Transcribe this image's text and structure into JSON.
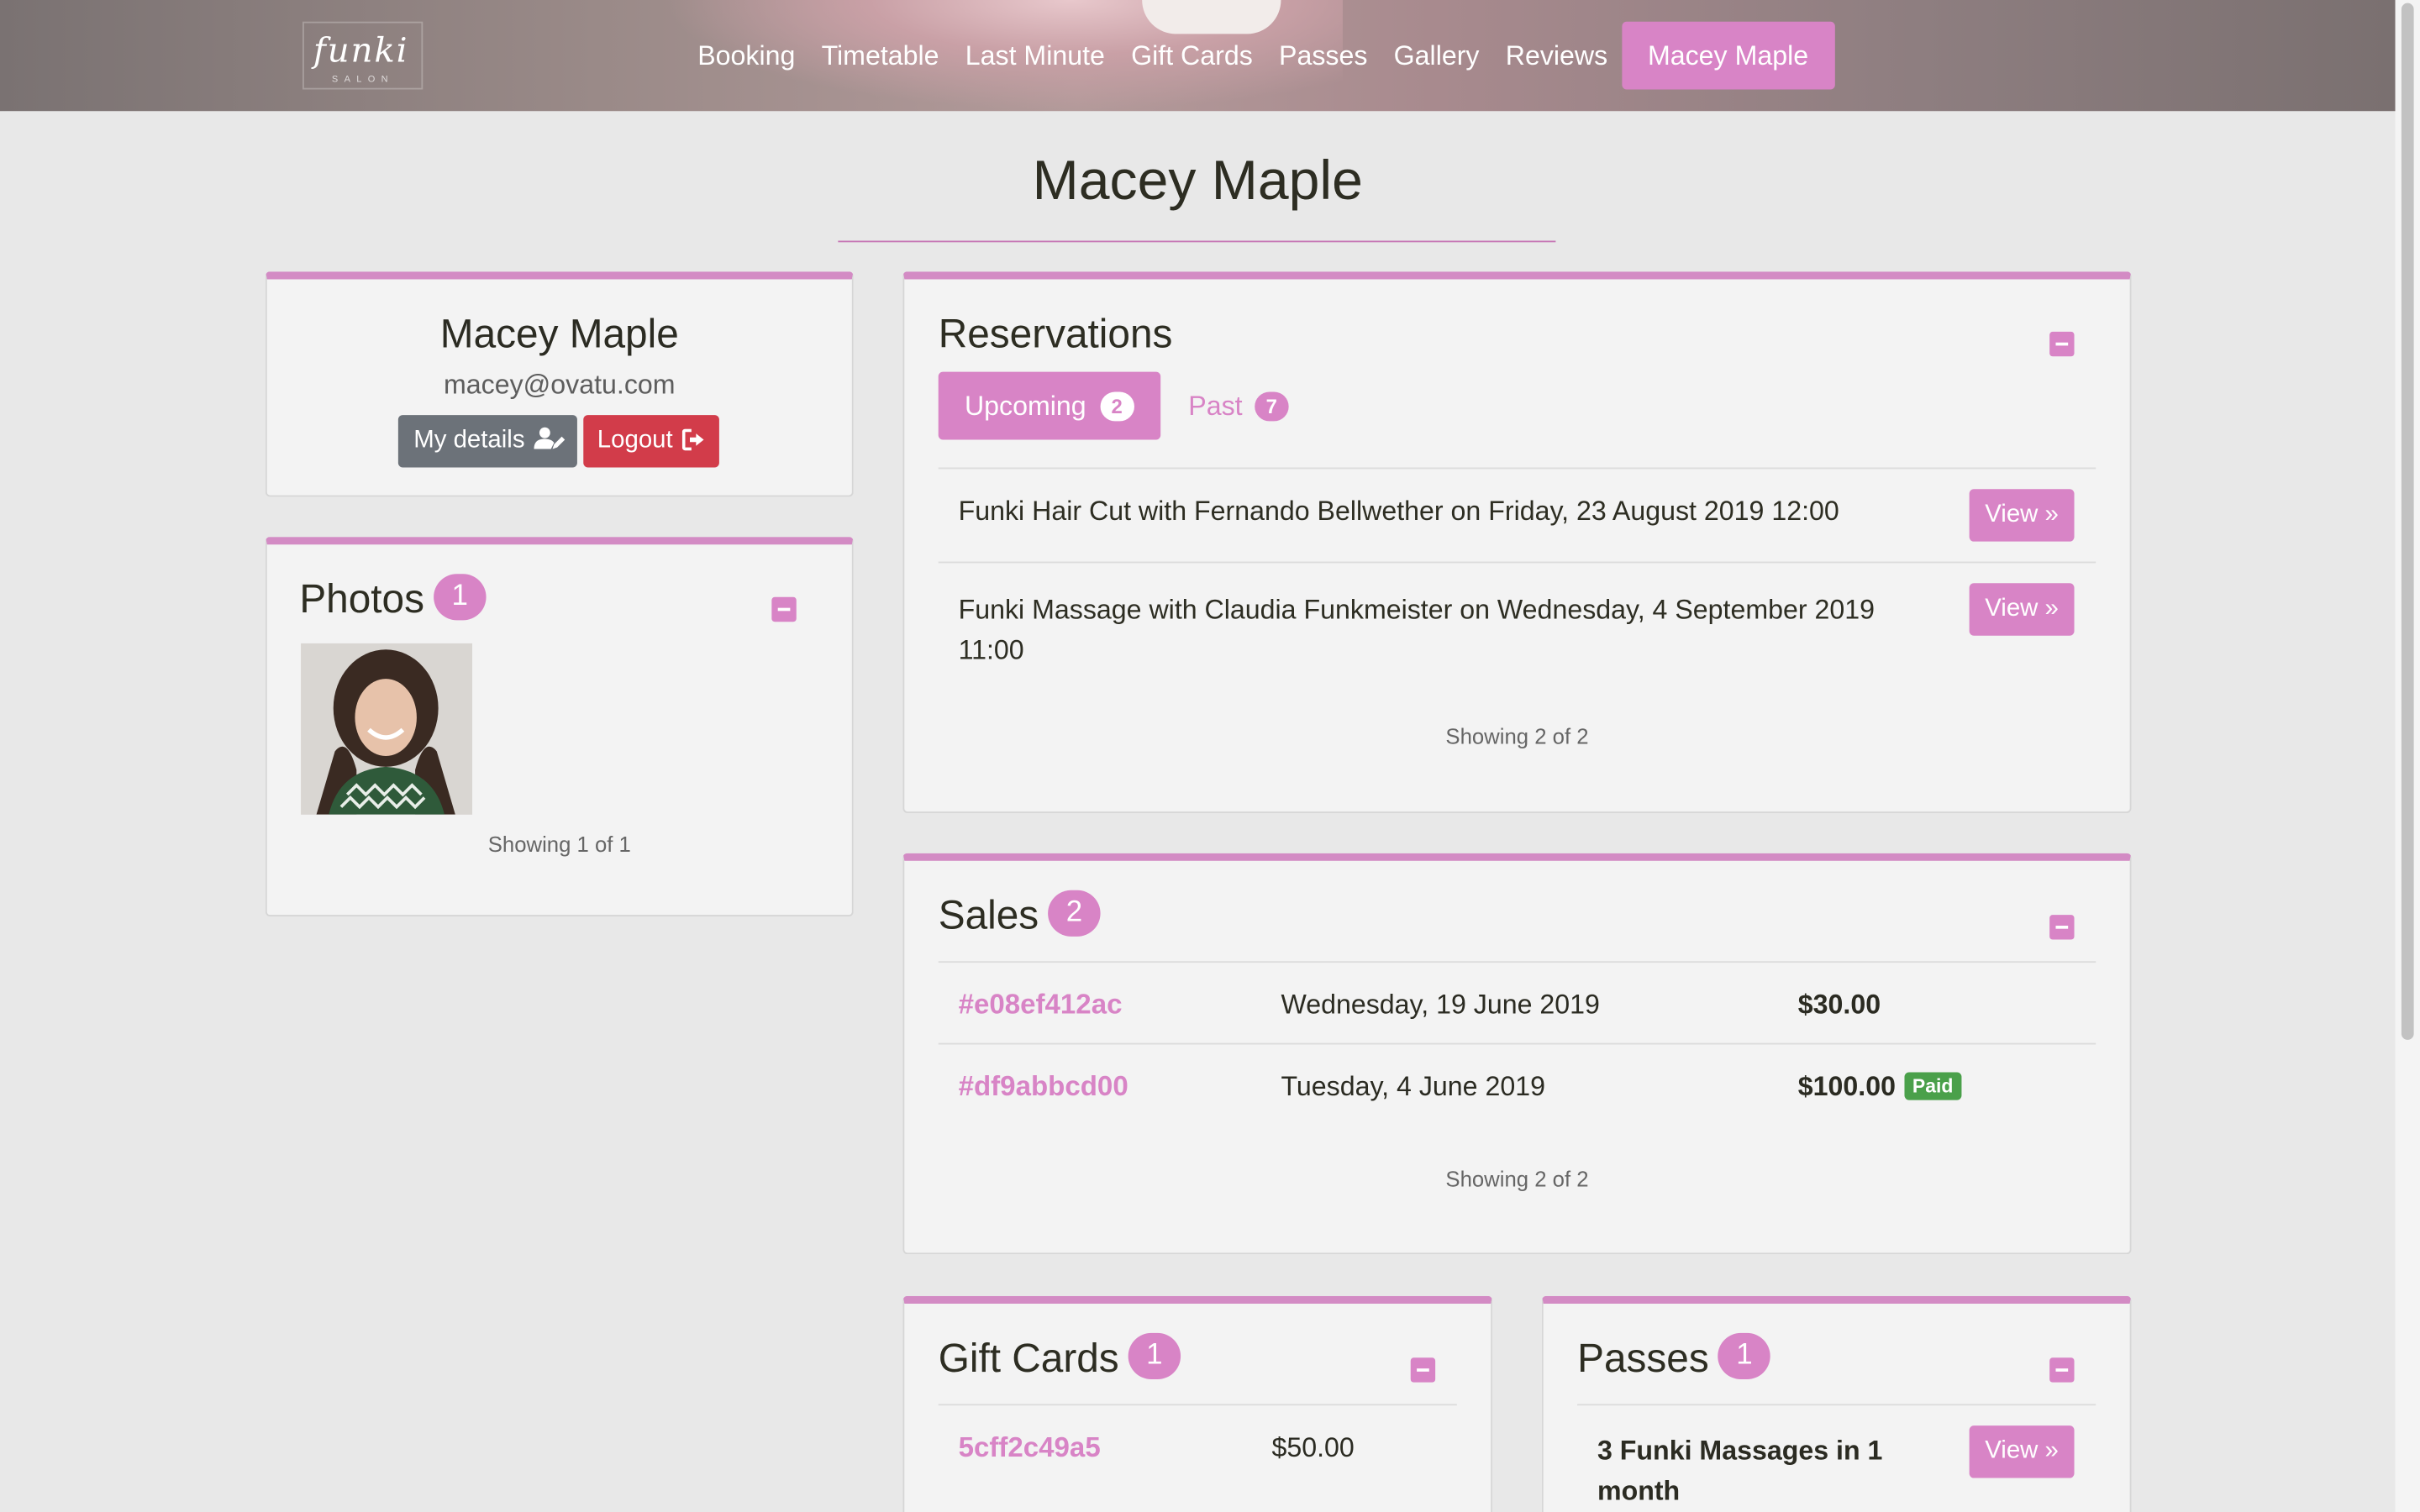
{
  "brand": {
    "logo_text": "funki",
    "logo_sub": "SALON"
  },
  "nav": {
    "items": [
      "Booking",
      "Timetable",
      "Last Minute",
      "Gift Cards",
      "Passes",
      "Gallery",
      "Reviews"
    ],
    "user": "Macey Maple"
  },
  "page_title": "Macey Maple",
  "profile": {
    "name": "Macey Maple",
    "email": "macey@ovatu.com",
    "details_button": "My details",
    "logout_button": "Logout"
  },
  "photos": {
    "title": "Photos",
    "count": "1",
    "showing": "Showing 1 of 1"
  },
  "reservations": {
    "title": "Reservations",
    "tabs": [
      {
        "label": "Upcoming",
        "count": "2"
      },
      {
        "label": "Past",
        "count": "7"
      }
    ],
    "items": [
      {
        "text": "Funki Hair Cut with Fernando Bellwether on Friday, 23 August 2019 12:00",
        "button": "View »"
      },
      {
        "text_line1": "Funki Massage with Claudia Funkmeister on Wednesday, 4 September 2019",
        "text_line2": "11:00",
        "button": "View »"
      }
    ],
    "showing": "Showing 2 of 2"
  },
  "sales": {
    "title": "Sales",
    "count": "2",
    "rows": [
      {
        "id": "#e08ef412ac",
        "date": "Wednesday, 19 June 2019",
        "amount": "$30.00",
        "status": ""
      },
      {
        "id": "#df9abbcd00",
        "date": "Tuesday, 4 June 2019",
        "amount": "$100.00",
        "status": "Paid"
      }
    ],
    "showing": "Showing 2 of 2"
  },
  "gift_cards": {
    "title": "Gift Cards",
    "count": "1",
    "rows": [
      {
        "code": "5cff2c49a5",
        "value": "$50.00"
      }
    ]
  },
  "passes": {
    "title": "Passes",
    "count": "1",
    "rows": [
      {
        "name_line1": "3 Funki Massages in 1",
        "name_line2": "month",
        "button": "View »"
      }
    ]
  },
  "colors": {
    "accent": "#d884c6",
    "danger": "#d23c4a",
    "secondary": "#6c7279",
    "success": "#4aa04a"
  }
}
